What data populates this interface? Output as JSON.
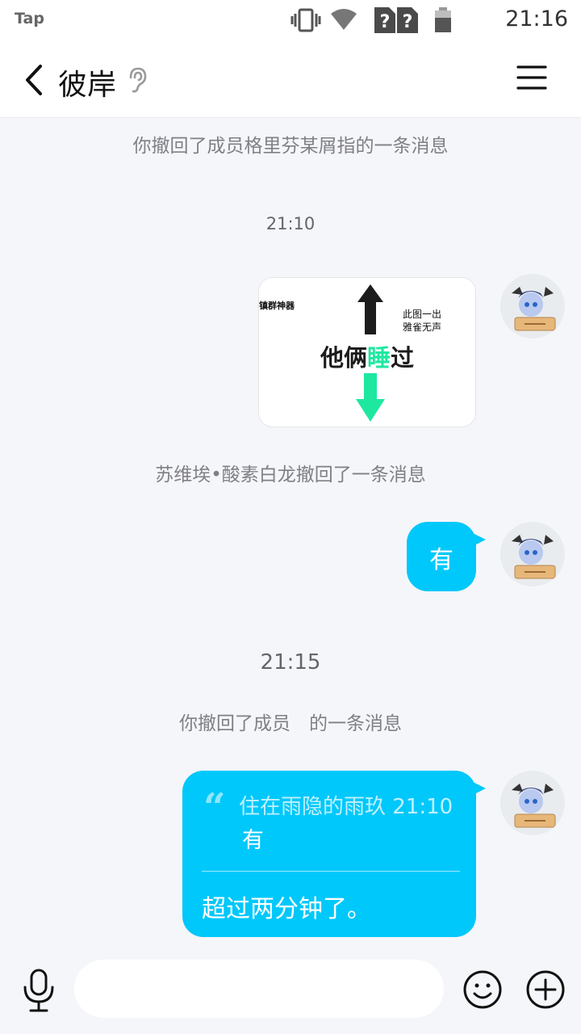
{
  "status_bar": {
    "app_label": "Tap",
    "time": "21:16",
    "icons": [
      "vibrate-icon",
      "wifi-icon",
      "sim-unknown-icon",
      "sim-unknown-icon",
      "battery-icon"
    ]
  },
  "header": {
    "title": "彼岸",
    "back_icon": "chevron-left-icon",
    "ear_icon": "ear-icon",
    "menu_icon": "hamburger-menu-icon"
  },
  "messages": {
    "sys1": "你撤回了成员格里芬某屑指的一条消息",
    "time1": "21:10",
    "image": {
      "top_left": "镇群神器",
      "top_right_line1": "此图一出",
      "top_right_line2": "雅雀无声",
      "center_a": "他俩",
      "center_b": "睡",
      "center_c": "过",
      "arrow_up_color": "#1c1c1c",
      "arrow_down_color": "#1ee8a0"
    },
    "sys2": "苏维埃•酸素白龙撤回了一条消息",
    "bubble1": "有",
    "time2": "21:15",
    "sys3": "你撤回了成员　的一条消息",
    "bubble2": {
      "quote_mark": "“",
      "quote_author_time": "住在雨隐的雨玖 21:10",
      "quote_text": "有",
      "reply": "超过两分钟了。"
    }
  },
  "input_bar": {
    "placeholder": "",
    "mic_icon": "microphone-icon",
    "emoji_icon": "emoji-icon",
    "plus_icon": "plus-icon"
  },
  "colors": {
    "bubble": "#00c8fb",
    "background": "#f5f6fa"
  }
}
